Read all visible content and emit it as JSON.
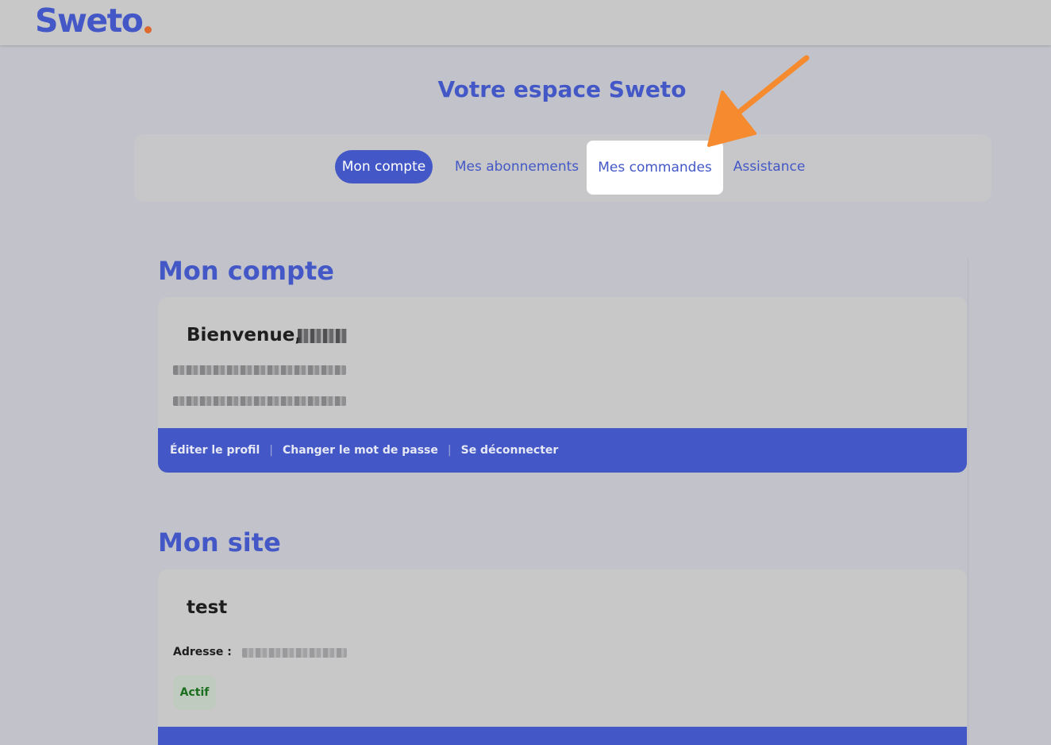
{
  "header": {
    "logo_text": "Sweto"
  },
  "page": {
    "title": "Votre espace Sweto"
  },
  "tabs": [
    {
      "label": "Mon compte",
      "active": true
    },
    {
      "label": "Mes abonnements",
      "active": false
    },
    {
      "label": "Mes commandes",
      "active": false,
      "highlighted": true
    },
    {
      "label": "Assistance",
      "active": false
    }
  ],
  "account": {
    "section_title": "Mon compte",
    "greeting": "Bienvenue,",
    "footer_links": [
      "Éditer le profil",
      "Changer le mot de passe",
      "Se déconnecter"
    ]
  },
  "site": {
    "section_title": "Mon site",
    "name": "test",
    "address_label": "Adresse :",
    "status": "Actif"
  },
  "colors": {
    "brand": "#4358c6",
    "accent": "#dd6a2c",
    "arrow": "#f58a2e",
    "status_green": "#1b6e1d"
  }
}
